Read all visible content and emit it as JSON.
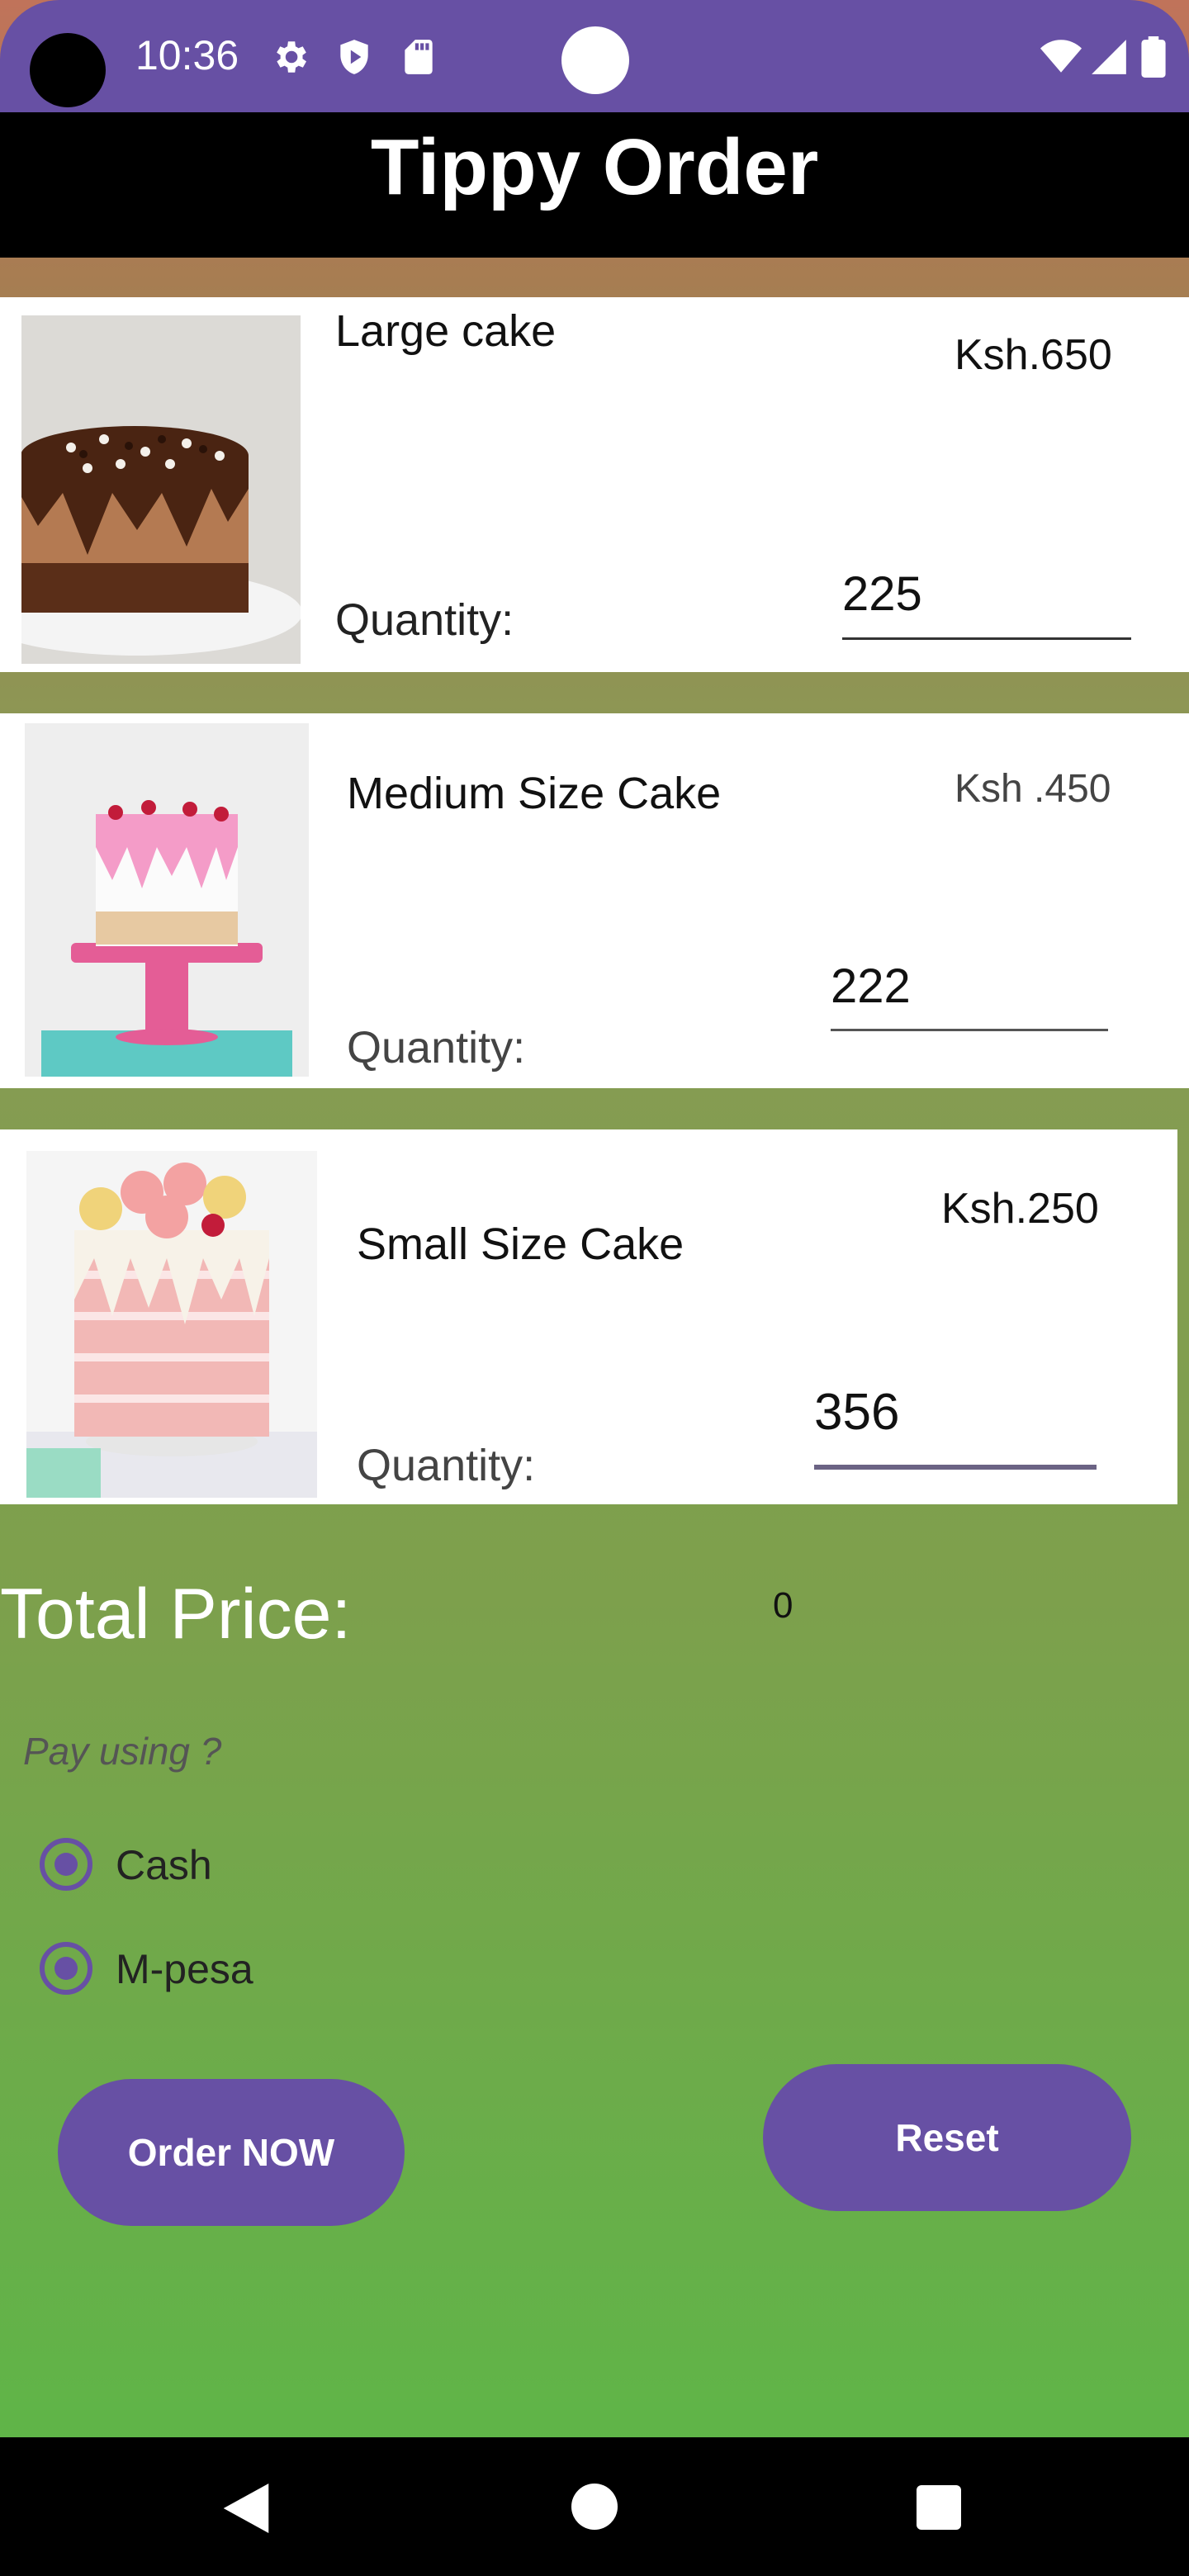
{
  "status_bar": {
    "time": "10:36",
    "icons": [
      "settings-icon",
      "shield-play-icon",
      "sd-card-icon",
      "wifi-icon",
      "signal-icon",
      "battery-icon"
    ]
  },
  "app": {
    "title": "Tippy Order"
  },
  "products": [
    {
      "name": "Large cake",
      "price": "Ksh.650",
      "quantity_label": "Quantity:",
      "quantity": "225"
    },
    {
      "name": "Medium Size Cake",
      "price": "Ksh .450",
      "quantity_label": "Quantity:",
      "quantity": "222"
    },
    {
      "name": "Small Size Cake",
      "price": "Ksh.250",
      "quantity_label": "Quantity:",
      "quantity": "356"
    }
  ],
  "total": {
    "label": "Total Price:",
    "value": "0"
  },
  "payment": {
    "question": "Pay using ?",
    "options": [
      {
        "label": "Cash",
        "checked": true
      },
      {
        "label": "M-pesa",
        "checked": true
      }
    ]
  },
  "buttons": {
    "order": "Order NOW",
    "reset": "Reset"
  },
  "nav_bar": {
    "icons": [
      "back-icon",
      "home-icon",
      "recents-icon"
    ]
  },
  "colors": {
    "primary": "#6750a4",
    "title_bar": "#000000",
    "text_light": "#ffffff"
  }
}
